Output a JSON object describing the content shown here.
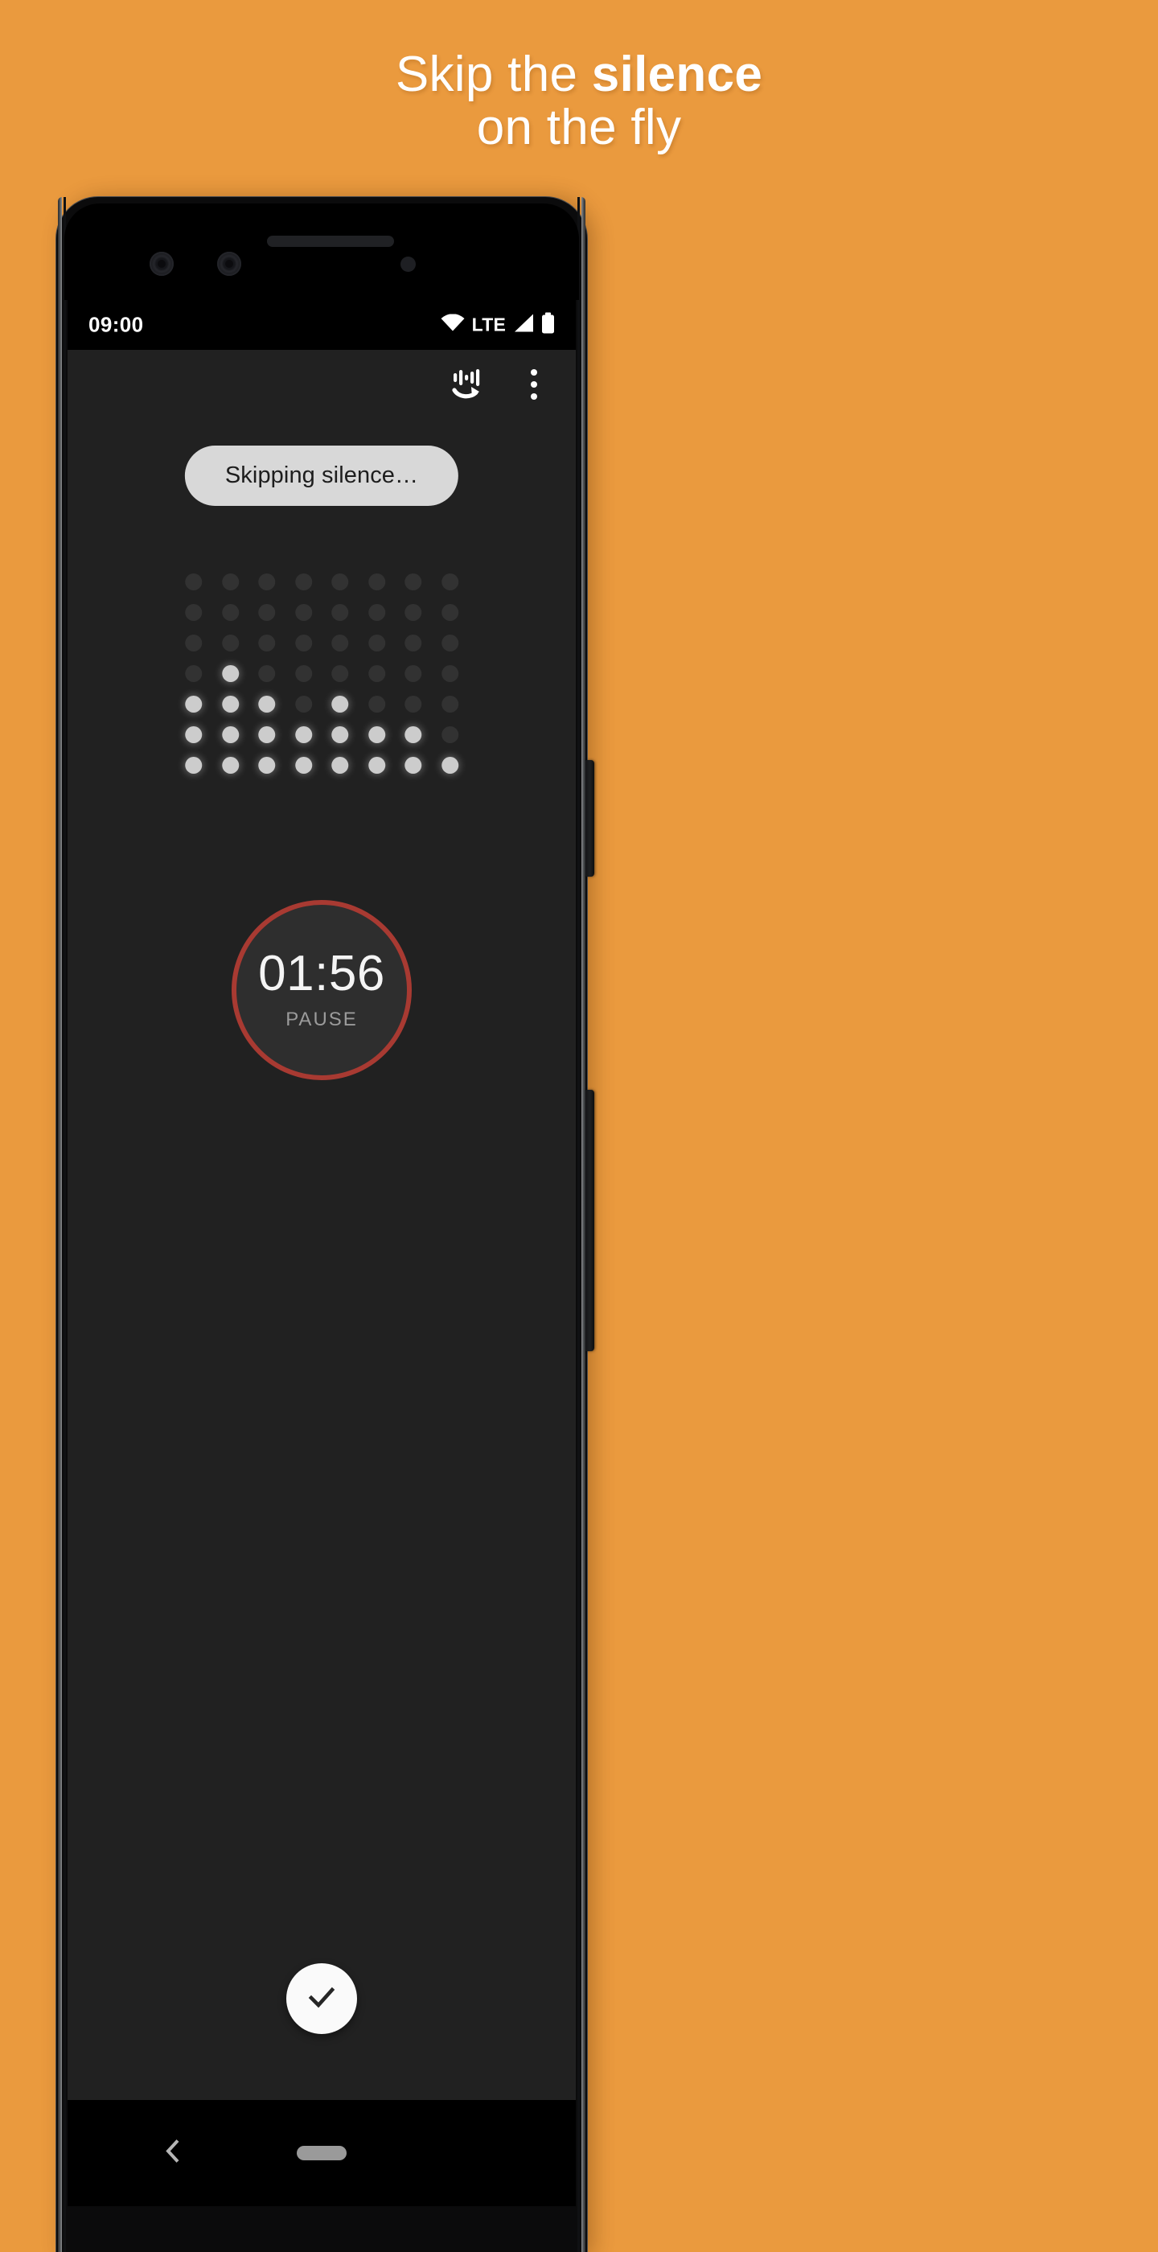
{
  "promo": {
    "background_color": "#ea9a3e",
    "headline_line1_plain": "Skip the ",
    "headline_line1_bold": "silence",
    "headline_line2": "on the fly"
  },
  "status_bar": {
    "time": "09:00",
    "network_label": "LTE",
    "icons": [
      "wifi-icon",
      "signal-icon",
      "battery-icon"
    ]
  },
  "app": {
    "background_color": "#212121",
    "toolbar": {
      "skip_silence_icon": "skip-silence-icon",
      "overflow_icon": "overflow-menu-icon"
    },
    "status_chip": {
      "label": "Skipping silence…",
      "background_color": "#d8d8d8",
      "text_color": "#1d1d1d"
    },
    "visualizer": {
      "columns": 8,
      "rows": 7,
      "levels": [
        3,
        4,
        3,
        2,
        3,
        2,
        2,
        1
      ],
      "on_color": "#cccccc",
      "off_color": "#323232"
    },
    "recorder": {
      "elapsed": "01:56",
      "action_label": "PAUSE",
      "ring_color": "#a83a32",
      "fill_color": "#2e2e2e"
    },
    "confirm_button": {
      "icon": "check-icon",
      "background_color": "#fafafa"
    }
  },
  "nav_bar": {
    "back_icon": "back-chevron-icon",
    "home_icon": "home-pill-icon"
  }
}
